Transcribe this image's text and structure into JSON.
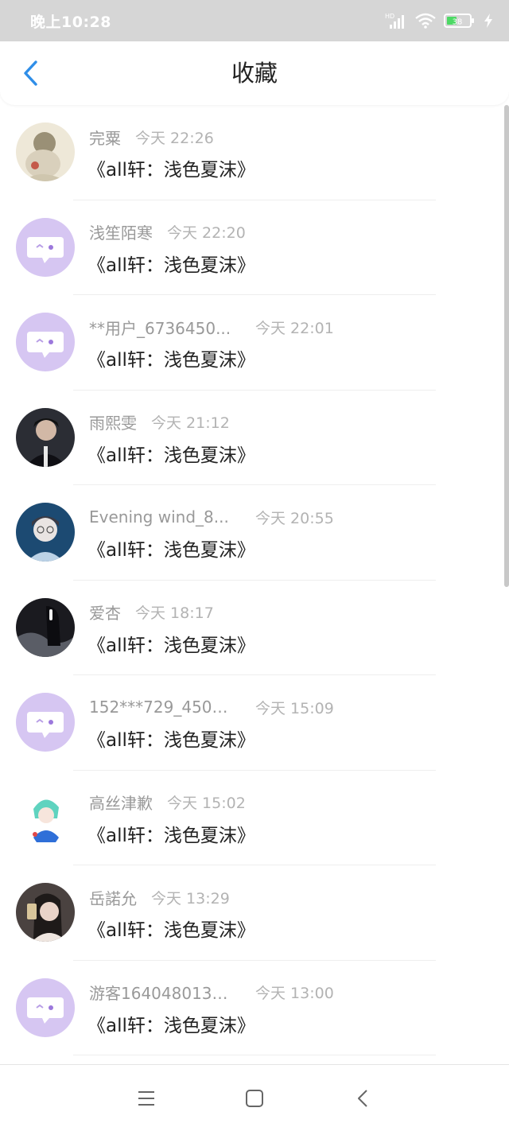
{
  "status_bar": {
    "time": "晚上10:28",
    "battery_level": "38",
    "network_label": "HD"
  },
  "header": {
    "title": "收藏"
  },
  "items": [
    {
      "username": "完粟",
      "time": "今天 22:26",
      "title": "《all轩：浅色夏沫》",
      "avatar": "illustration-avatar"
    },
    {
      "username": "浅笙陌寒",
      "time": "今天 22:20",
      "title": "《all轩：浅色夏沫》",
      "avatar": "default-chat-avatar"
    },
    {
      "username": "**用户_6736450...",
      "time": "今天 22:01",
      "title": "《all轩：浅色夏沫》",
      "avatar": "default-chat-avatar"
    },
    {
      "username": "雨熙雯",
      "time": "今天 21:12",
      "title": "《all轩：浅色夏沫》",
      "avatar": "dark-photo-avatar"
    },
    {
      "username": "Evening wind_8...",
      "time": "今天 20:55",
      "title": "《all轩：浅色夏沫》",
      "avatar": "blue-photo-avatar"
    },
    {
      "username": "爱杏",
      "time": "今天 18:17",
      "title": "《all轩：浅色夏沫》",
      "avatar": "night-photo-avatar"
    },
    {
      "username": "152***729_4509...",
      "time": "今天 15:09",
      "title": "《all轩：浅色夏沫》",
      "avatar": "default-chat-avatar"
    },
    {
      "username": "高丝津歉",
      "time": "今天 15:02",
      "title": "《all轩：浅色夏沫》",
      "avatar": "anime-avatar"
    },
    {
      "username": "岳諾允",
      "time": "今天 13:29",
      "title": "《all轩：浅色夏沫》",
      "avatar": "selfie-avatar"
    },
    {
      "username": "游客1640480138...",
      "time": "今天 13:00",
      "title": "《all轩：浅色夏沫》",
      "avatar": "default-chat-avatar"
    }
  ],
  "colors": {
    "accent": "#2f8ee8",
    "default_avatar_bg": "#d6c6f2",
    "username": "#999999",
    "timestamp": "#b3b3b3",
    "title": "#222222"
  },
  "nav": {
    "menu_icon": "menu-icon",
    "home_icon": "home-square-icon",
    "back_icon": "back-triangle-icon"
  }
}
